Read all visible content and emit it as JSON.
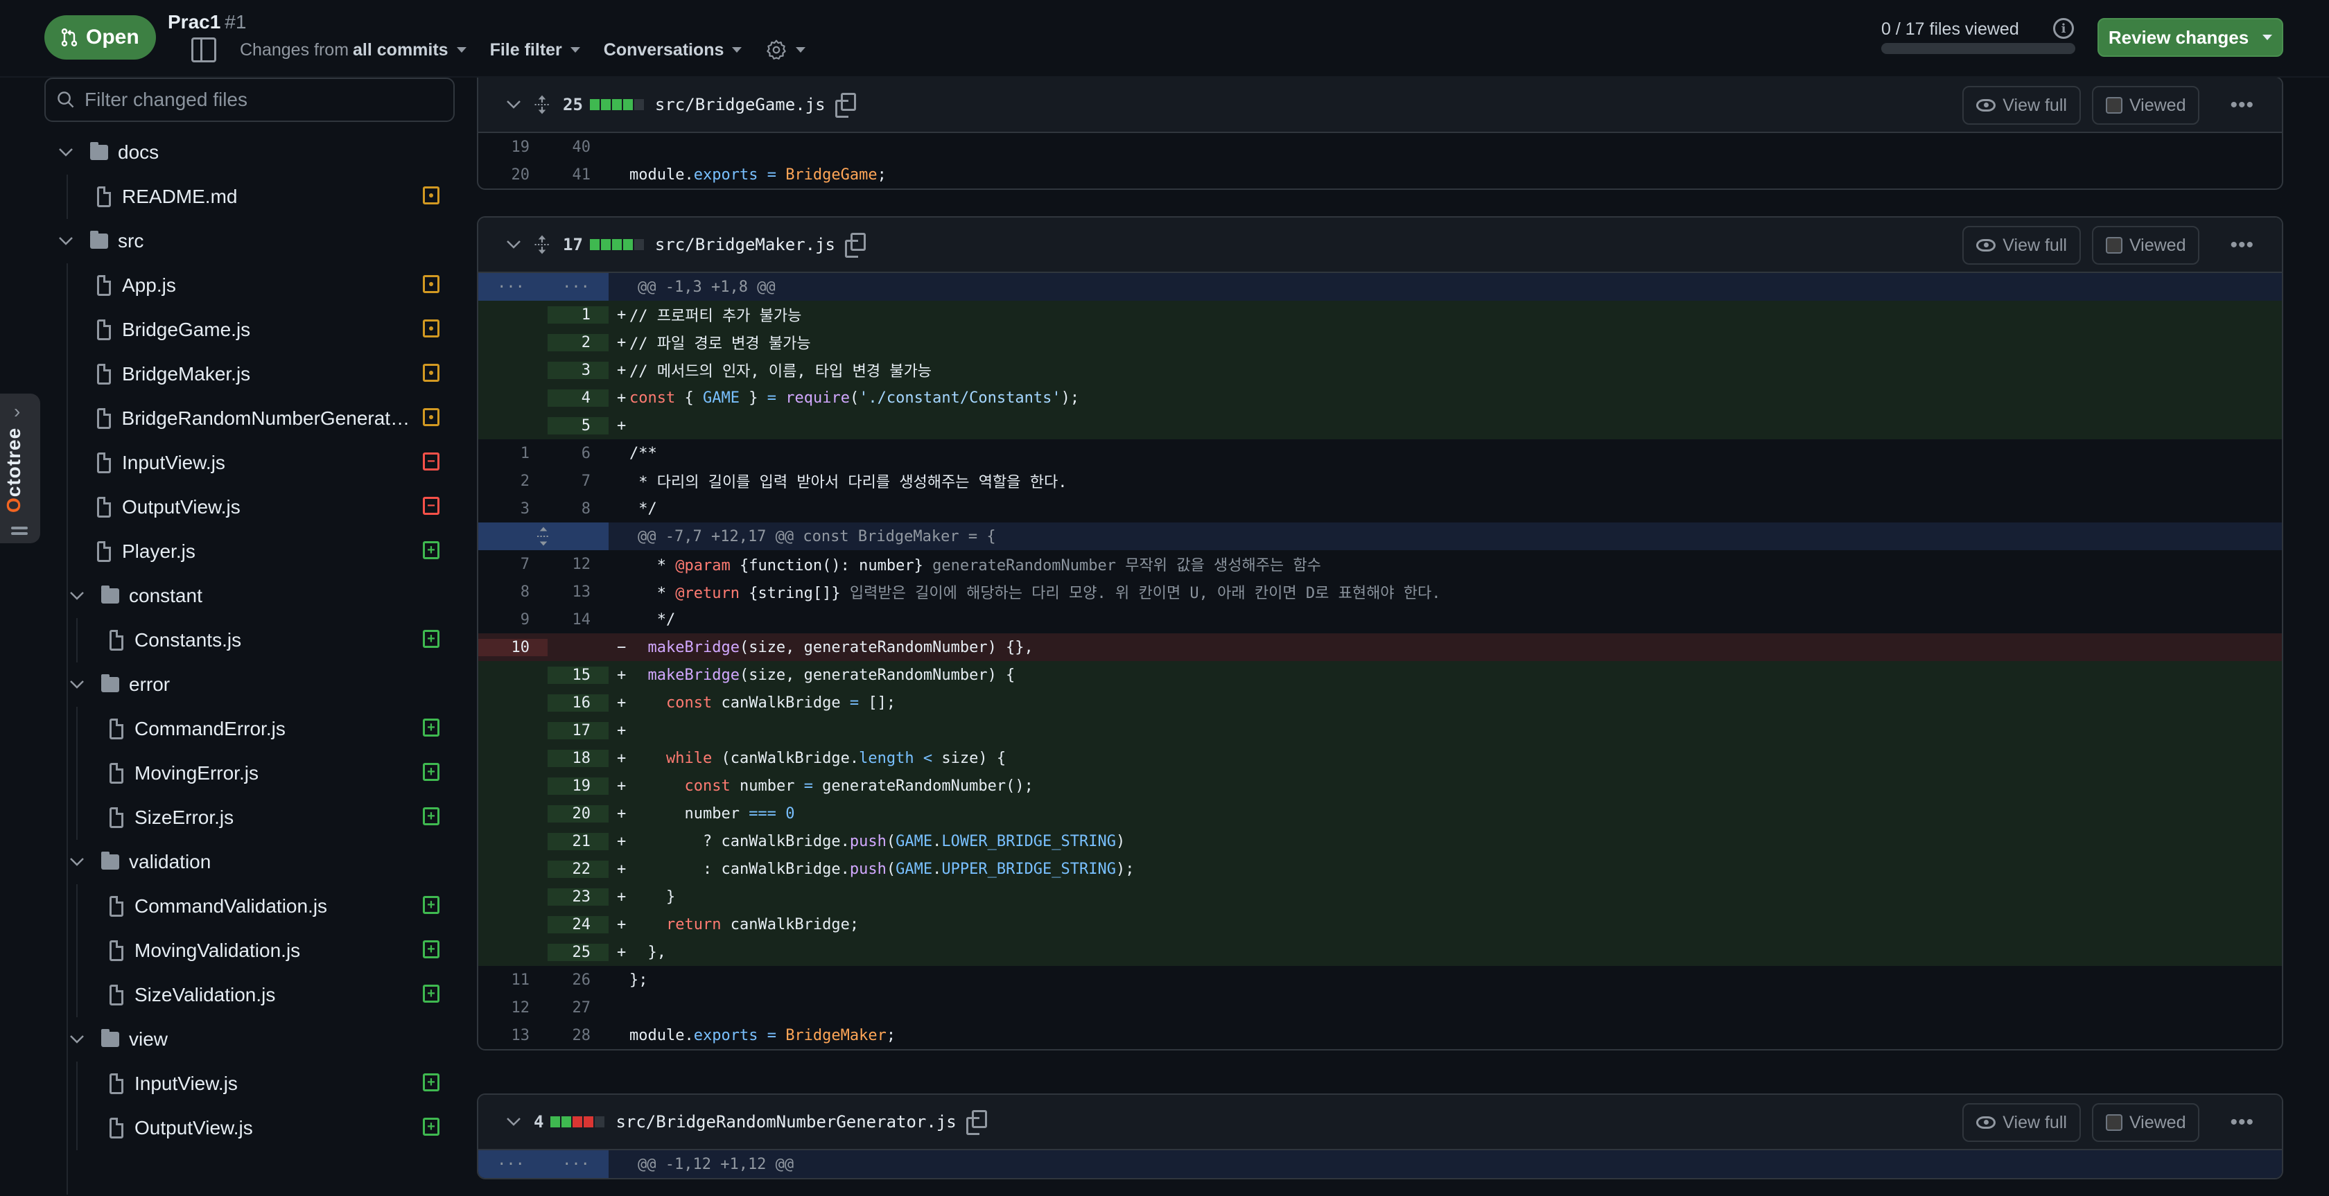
{
  "header": {
    "status_label": "Open",
    "pr_title": "Prac1",
    "pr_number": "#1",
    "toolbar": {
      "changes_prefix": "Changes from",
      "changes_value": "all commits",
      "file_filter": "File filter",
      "conversations": "Conversations"
    },
    "files_viewed": "0 / 17 files viewed",
    "files_viewed_progress": 0,
    "review_button": "Review changes"
  },
  "sidebar": {
    "filter_placeholder": "Filter changed files",
    "octotree_label": "ctotree",
    "octotree_first": "O",
    "tree": [
      {
        "type": "folder",
        "name": "docs",
        "depth": 0
      },
      {
        "type": "file",
        "name": "README.md",
        "depth": 1,
        "status": "modified"
      },
      {
        "type": "folder",
        "name": "src",
        "depth": 0
      },
      {
        "type": "file",
        "name": "App.js",
        "depth": 1,
        "status": "modified"
      },
      {
        "type": "file",
        "name": "BridgeGame.js",
        "depth": 1,
        "status": "modified"
      },
      {
        "type": "file",
        "name": "BridgeMaker.js",
        "depth": 1,
        "status": "modified"
      },
      {
        "type": "file",
        "name": "BridgeRandomNumberGenerator.js",
        "depth": 1,
        "status": "modified"
      },
      {
        "type": "file",
        "name": "InputView.js",
        "depth": 1,
        "status": "removed"
      },
      {
        "type": "file",
        "name": "OutputView.js",
        "depth": 1,
        "status": "removed"
      },
      {
        "type": "file",
        "name": "Player.js",
        "depth": 1,
        "status": "added"
      },
      {
        "type": "folder",
        "name": "constant",
        "depth": 1
      },
      {
        "type": "file",
        "name": "Constants.js",
        "depth": 2,
        "status": "added"
      },
      {
        "type": "folder",
        "name": "error",
        "depth": 1
      },
      {
        "type": "file",
        "name": "CommandError.js",
        "depth": 2,
        "status": "added"
      },
      {
        "type": "file",
        "name": "MovingError.js",
        "depth": 2,
        "status": "added"
      },
      {
        "type": "file",
        "name": "SizeError.js",
        "depth": 2,
        "status": "added"
      },
      {
        "type": "folder",
        "name": "validation",
        "depth": 1
      },
      {
        "type": "file",
        "name": "CommandValidation.js",
        "depth": 2,
        "status": "added"
      },
      {
        "type": "file",
        "name": "MovingValidation.js",
        "depth": 2,
        "status": "added"
      },
      {
        "type": "file",
        "name": "SizeValidation.js",
        "depth": 2,
        "status": "added"
      },
      {
        "type": "folder",
        "name": "view",
        "depth": 1
      },
      {
        "type": "file",
        "name": "InputView.js",
        "depth": 2,
        "status": "added"
      },
      {
        "type": "file",
        "name": "OutputView.js",
        "depth": 2,
        "status": "added"
      }
    ]
  },
  "file_actions": {
    "view_full": "View full",
    "viewed": "Viewed"
  },
  "files": [
    {
      "path": "src/BridgeGame.js",
      "changes": "25",
      "diffstat": [
        "add",
        "add",
        "add",
        "add",
        "neutral"
      ],
      "lines": [
        {
          "type": "ctx",
          "old": "19",
          "new": "40",
          "html": ""
        },
        {
          "type": "ctx",
          "old": "20",
          "new": "41",
          "html": "module.<span class='prop'>exports</span> <span class='op'>=</span> <span class='cls'>BridgeGame</span>;"
        }
      ]
    },
    {
      "path": "src/BridgeMaker.js",
      "changes": "17",
      "diffstat": [
        "add",
        "add",
        "add",
        "add",
        "neutral"
      ],
      "lines": [
        {
          "type": "hunk",
          "text": "@@ -1,3 +1,8 @@",
          "gutter": "dots"
        },
        {
          "type": "add",
          "old": "",
          "new": "1",
          "html": "// 프로퍼티 추가 불가능"
        },
        {
          "type": "add",
          "old": "",
          "new": "2",
          "html": "// 파일 경로 변경 불가능"
        },
        {
          "type": "add",
          "old": "",
          "new": "3",
          "html": "// 메서드의 인자, 이름, 타입 변경 불가능"
        },
        {
          "type": "add",
          "old": "",
          "new": "4",
          "html": "<span class='kw'>const</span> { <span class='prop'>GAME</span> } <span class='op'>=</span> <span class='fn'>require</span>(<span class='str'>'./constant/Constants'</span>);"
        },
        {
          "type": "add",
          "old": "",
          "new": "5",
          "html": ""
        },
        {
          "type": "ctx",
          "old": "1",
          "new": "6",
          "html": "/**"
        },
        {
          "type": "ctx",
          "old": "2",
          "new": "7",
          "html": " * 다리의 길이를 입력 받아서 다리를 생성해주는 역할을 한다."
        },
        {
          "type": "ctx",
          "old": "3",
          "new": "8",
          "html": " */"
        },
        {
          "type": "hunk",
          "text": "@@ -7,7 +12,17 @@ const BridgeMaker = {",
          "gutter": "expand"
        },
        {
          "type": "ctx",
          "old": "7",
          "new": "12",
          "html": "   * <span class='kw'>@param</span> {function(): number} <span class='cm'>generateRandomNumber 무작위 값을 생성해주는 함수</span>"
        },
        {
          "type": "ctx",
          "old": "8",
          "new": "13",
          "html": "   * <span class='kw'>@return</span> {string[]} <span class='cm'>입력받은 길이에 해당하는 다리 모양. 위 칸이면 U, 아래 칸이면 D로 표현해야 한다.</span>"
        },
        {
          "type": "ctx",
          "old": "9",
          "new": "14",
          "html": "   */"
        },
        {
          "type": "del",
          "old": "10",
          "new": "",
          "html": "  <span class='fn'>makeBridge</span>(size, generateRandomNumber) {},"
        },
        {
          "type": "add",
          "old": "",
          "new": "15",
          "html": "  <span class='fn'>makeBridge</span>(size, generateRandomNumber) {"
        },
        {
          "type": "add",
          "old": "",
          "new": "16",
          "html": "    <span class='kw'>const</span> canWalkBridge <span class='op'>=</span> [];"
        },
        {
          "type": "add",
          "old": "",
          "new": "17",
          "html": ""
        },
        {
          "type": "add",
          "old": "",
          "new": "18",
          "html": "    <span class='kw'>while</span> (canWalkBridge.<span class='prop'>length</span> <span class='op'>&lt;</span> size) {"
        },
        {
          "type": "add",
          "old": "",
          "new": "19",
          "html": "      <span class='kw'>const</span> number <span class='op'>=</span> generateRandomNumber();"
        },
        {
          "type": "add",
          "old": "",
          "new": "20",
          "html": "      number <span class='op'>===</span> <span class='prop'>0</span>"
        },
        {
          "type": "add",
          "old": "",
          "new": "21",
          "html": "        ? canWalkBridge.<span class='fn'>push</span>(<span class='prop'>GAME</span>.<span class='prop'>LOWER_BRIDGE_STRING</span>)"
        },
        {
          "type": "add",
          "old": "",
          "new": "22",
          "html": "        : canWalkBridge.<span class='fn'>push</span>(<span class='prop'>GAME</span>.<span class='prop'>UPPER_BRIDGE_STRING</span>);"
        },
        {
          "type": "add",
          "old": "",
          "new": "23",
          "html": "    }"
        },
        {
          "type": "add",
          "old": "",
          "new": "24",
          "html": "    <span class='kw'>return</span> canWalkBridge;"
        },
        {
          "type": "add",
          "old": "",
          "new": "25",
          "html": "  },"
        },
        {
          "type": "ctx",
          "old": "11",
          "new": "26",
          "html": "};"
        },
        {
          "type": "ctx",
          "old": "12",
          "new": "27",
          "html": ""
        },
        {
          "type": "ctx",
          "old": "13",
          "new": "28",
          "html": "module.<span class='prop'>exports</span> <span class='op'>=</span> <span class='cls'>BridgeMaker</span>;"
        }
      ]
    },
    {
      "path": "src/BridgeRandomNumberGenerator.js",
      "changes": "4",
      "diffstat": [
        "add",
        "add",
        "del",
        "del",
        "neutral"
      ],
      "lines": [
        {
          "type": "hunk",
          "text": "@@ -1,12 +1,12 @@",
          "gutter": "dots"
        }
      ]
    }
  ]
}
